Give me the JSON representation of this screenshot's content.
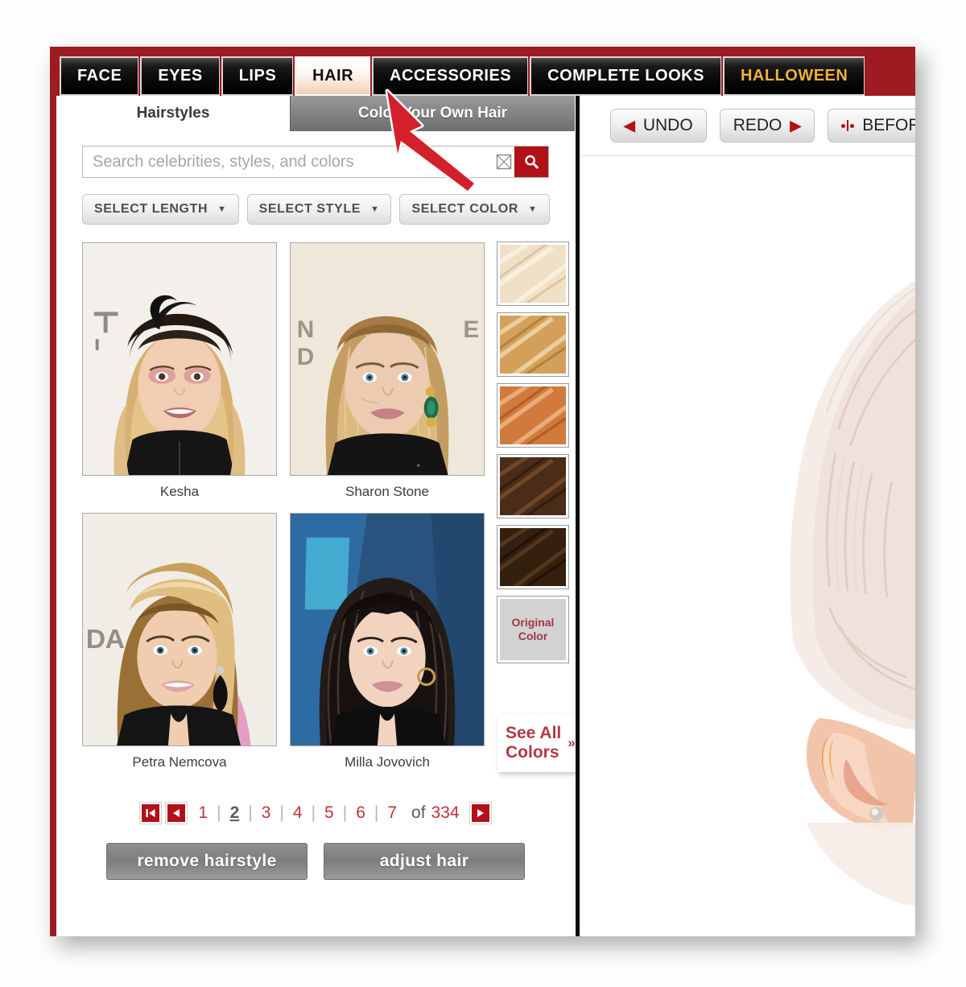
{
  "app": {
    "frame_color": "#9e1b22",
    "nav": [
      {
        "label": "FACE",
        "active": false
      },
      {
        "label": "EYES",
        "active": false
      },
      {
        "label": "LIPS",
        "active": false
      },
      {
        "label": "HAIR",
        "active": true
      },
      {
        "label": "ACCESSORIES",
        "active": false
      },
      {
        "label": "COMPLETE LOOKS",
        "active": false
      },
      {
        "label": "HALLOWEEN",
        "active": false,
        "accent": "#f0b23c"
      }
    ]
  },
  "left_panel": {
    "tabs": [
      {
        "label": "Hairstyles",
        "active": true
      },
      {
        "label": "Color Your Own Hair",
        "active": false
      }
    ],
    "search": {
      "value": "",
      "placeholder": "Search celebrities, styles, and colors",
      "clear_icon": "close-box-icon",
      "submit_icon": "magnifier-icon",
      "submit_color": "#b01218"
    },
    "filters": [
      {
        "label": "SELECT LENGTH",
        "caret": "▼"
      },
      {
        "label": "SELECT STYLE",
        "caret": "▼"
      },
      {
        "label": "SELECT COLOR",
        "caret": "▼"
      }
    ],
    "gallery": [
      {
        "name": "Kesha"
      },
      {
        "name": "Sharon Stone"
      },
      {
        "name": "Petra Nemcova"
      },
      {
        "name": "Milla Jovovich"
      }
    ],
    "swatches": [
      {
        "name": "platinum-blonde",
        "base": "#efe0c6",
        "light": "#fbf4e6",
        "dark": "#cdb793"
      },
      {
        "name": "golden-blonde",
        "base": "#d3a05c",
        "light": "#f0d6a8",
        "dark": "#a8762f"
      },
      {
        "name": "copper-red",
        "base": "#d07a3c",
        "light": "#edb484",
        "dark": "#a7521c"
      },
      {
        "name": "medium-brown",
        "base": "#4a2c18",
        "light": "#7a4f2d",
        "dark": "#2c180b"
      },
      {
        "name": "dark-brown",
        "base": "#33200f",
        "light": "#5d3c1f",
        "dark": "#1a0e05"
      }
    ],
    "original_color": {
      "line1": "Original",
      "line2": "Color",
      "text_color": "#9c3a46"
    },
    "see_all_colors": {
      "line1": "See All",
      "line2": "Colors",
      "arrows": "»",
      "color": "#b03a44"
    },
    "pagination": {
      "first_icon": "first-page-icon",
      "prev_icon": "previous-page-icon",
      "next_icon": "next-page-icon",
      "pages": [
        "1",
        "2",
        "3",
        "4",
        "5",
        "6",
        "7"
      ],
      "current": "2",
      "separator": "|",
      "of_label": "of",
      "total": "334"
    },
    "actions": [
      {
        "label": "remove hairstyle"
      },
      {
        "label": "adjust hair"
      }
    ]
  },
  "right_panel": {
    "toolbar": [
      {
        "label": "UNDO",
        "icon": "chevron-left-icon",
        "icon_side": "left"
      },
      {
        "label": "REDO",
        "icon": "chevron-right-icon",
        "icon_side": "right"
      },
      {
        "label": "BEFORE",
        "icon": "before-after-icon",
        "icon_side": "left"
      }
    ]
  },
  "annotation": {
    "pointer_color": "#d3202a",
    "pointer_label": "red-arrow-pointer"
  }
}
